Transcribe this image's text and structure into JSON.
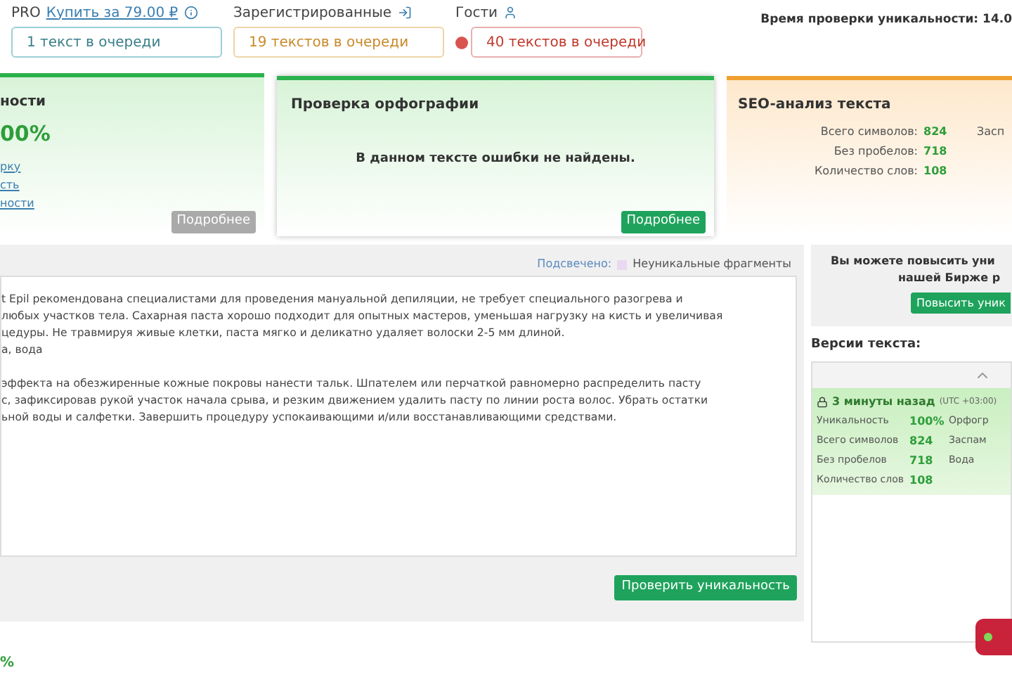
{
  "queues": [
    {
      "label": "PRO",
      "link": "Купить за 79.00 ₽",
      "count": "1 текст в очереди",
      "kind": "pro"
    },
    {
      "label": "Зарегистрированные",
      "count": "19 текстов в очереди",
      "kind": "registered"
    },
    {
      "label": "Гости",
      "count": "40 текстов в очереди",
      "kind": "guest"
    }
  ],
  "check_time": "Время проверки уникальности: 14.0",
  "cards": {
    "uniqueness": {
      "title": "ности",
      "value": "00%",
      "links": [
        "рку",
        "сть",
        "ности"
      ],
      "button": "Подробнее"
    },
    "spelling": {
      "title": "Проверка орфографии",
      "message": "В данном тексте ошибки не найдены.",
      "button": "Подробнее"
    },
    "seo": {
      "title": "SEO-анализ текста",
      "stats": [
        {
          "label": "Всего символов:",
          "value": "824"
        },
        {
          "label": "Без пробелов:",
          "value": "718"
        },
        {
          "label": "Количество слов:",
          "value": "108"
        }
      ],
      "cut_label": "Засп"
    }
  },
  "editor": {
    "legend_label": "Подсвечено:",
    "legend_text": "Неуникальные фрагменты",
    "paragraphs": [
      [
        "t Epil рекомендована специалистами для проведения мануальной депиляции, не требует специального разогрева и",
        "любых участков тела. Сахарная паста хорошо подходит для опытных мастеров, уменьшая нагрузку на кисть и увеличивая",
        "цедуры. Не травмируя живые клетки, паста мягко и деликатно удаляет волоски 2-5 мм длиной.",
        "а, вода"
      ],
      [
        "эффекта на обезжиренные кожные покровы нанести тальк. Шпателем или перчаткой равномерно распределить пасту",
        "с, зафиксировав рукой участок начала срыва, и резким движением удалить пасту по линии роста волос. Убрать остатки",
        "ьной воды и салфетки. Завершить процедуру успокаивающими и/или восстанавливающими средствами."
      ]
    ],
    "button": "Проверить уникальность",
    "result": "%"
  },
  "promo": {
    "text": [
      "Вы можете повысить уни",
      "нашей Бирже р"
    ],
    "button": "Повысить уник"
  },
  "versions": {
    "title": "Версии текста:",
    "items": [
      {
        "time": "3 минуты назад",
        "tz": "(UTC +03:00)",
        "locked": true,
        "rows": [
          [
            "Уникальность",
            "100%",
            "Орфогр"
          ],
          [
            "Всего символов",
            "824",
            "Заспам"
          ],
          [
            "Без пробелов",
            "718",
            "Вода"
          ],
          [
            "Количество слов",
            "108",
            ""
          ]
        ]
      }
    ]
  }
}
